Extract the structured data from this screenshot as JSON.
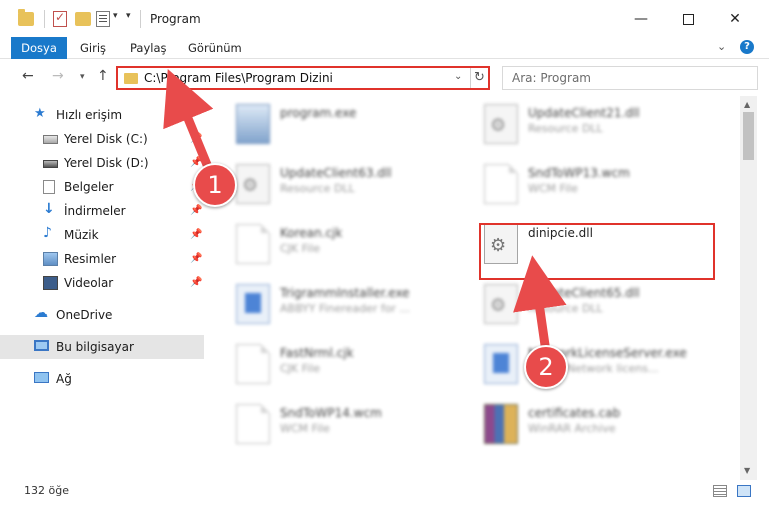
{
  "window": {
    "title": "Program",
    "minimize": "—",
    "close": "✕"
  },
  "quick_access_toolbar": {
    "dropdown_glyph": "▾",
    "customize_glyph": "▾"
  },
  "ribbon": {
    "tabs": [
      {
        "label": "Dosya",
        "active": true
      },
      {
        "label": "Giriş"
      },
      {
        "label": "Paylaş"
      },
      {
        "label": "Görünüm"
      }
    ],
    "expand_glyph": "⌄",
    "help_glyph": "?"
  },
  "navigation": {
    "back_glyph": "←",
    "forward_glyph": "→",
    "recent_glyph": "▾",
    "up_glyph": "↑",
    "address": "C:\\Program Files\\Program Dizini",
    "address_dropdown_glyph": "⌄",
    "refresh_glyph": "↻",
    "search_placeholder": "Ara: Program"
  },
  "sidebar": {
    "quick_access": {
      "label": "Hızlı erişim",
      "icon": "star-icon",
      "glyph": "★"
    },
    "items": [
      {
        "label": "Yerel Disk (C:)",
        "icon": "drive-icon",
        "pinned": true
      },
      {
        "label": "Yerel Disk (D:)",
        "icon": "drive-icon",
        "pinned": true
      },
      {
        "label": "Belgeler",
        "icon": "documents-icon",
        "pinned": true
      },
      {
        "label": "İndirmeler",
        "icon": "downloads-icon",
        "pinned": true,
        "glyph": "↓"
      },
      {
        "label": "Müzik",
        "icon": "music-icon",
        "pinned": true,
        "glyph": "♪"
      },
      {
        "label": "Resimler",
        "icon": "pictures-icon",
        "pinned": true
      },
      {
        "label": "Videolar",
        "icon": "videos-icon",
        "pinned": true
      }
    ],
    "pin_glyph": "📌",
    "onedrive": {
      "label": "OneDrive",
      "icon": "cloud-icon",
      "glyph": "☁"
    },
    "this_pc": {
      "label": "Bu bilgisayar",
      "icon": "computer-icon",
      "selected": true
    },
    "network": {
      "label": "Ağ",
      "icon": "network-icon"
    }
  },
  "files": [
    {
      "name": "program.exe",
      "type": "",
      "icon": "exe-icon"
    },
    {
      "name": "UpdateClient21.dll",
      "type": "Resource DLL",
      "icon": "dll-gear-icon"
    },
    {
      "name": "UpdateClient63.dll",
      "type": "Resource DLL",
      "icon": "dll-gear-icon"
    },
    {
      "name": "SndToWP13.wcm",
      "type": "WCM File",
      "icon": "file-icon"
    },
    {
      "name": "Korean.cjk",
      "type": "CJK File",
      "icon": "file-icon"
    },
    {
      "name": "dinipcie.dll",
      "type": "",
      "icon": "dll-gear-icon",
      "highlighted": true
    },
    {
      "name": "TrigrammInstaller.exe",
      "type": "ABBYY Finereader for ...",
      "icon": "installer-icon"
    },
    {
      "name": "UpdateClient65.dll",
      "type": "Resource DLL",
      "icon": "dll-gear-icon"
    },
    {
      "name": "FastNrml.cjk",
      "type": "CJK File",
      "icon": "file-icon"
    },
    {
      "name": "NetworkLicenseServer.exe",
      "type": "ABBYY Network licens...",
      "icon": "installer-icon"
    },
    {
      "name": "SndToWP14.wcm",
      "type": "WCM File",
      "icon": "file-icon"
    },
    {
      "name": "certificates.cab",
      "type": "WinRAR Archive",
      "icon": "winrar-icon"
    }
  ],
  "scrollbar": {
    "up_glyph": "▲",
    "down_glyph": "▼"
  },
  "status": {
    "item_count": "132 öğe"
  },
  "annotations": {
    "step1": "1",
    "step2": "2",
    "color": "#e84b4b"
  }
}
